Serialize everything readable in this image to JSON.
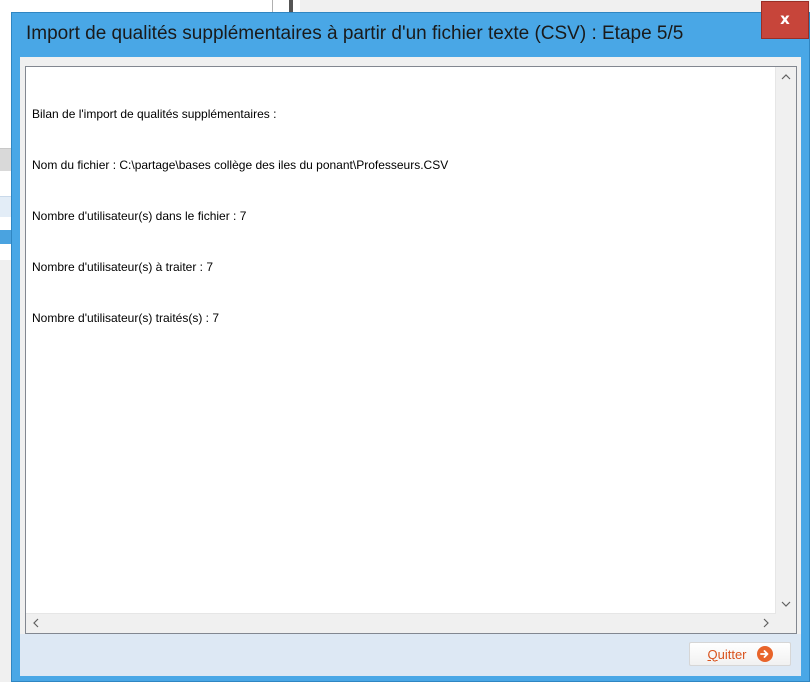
{
  "window": {
    "title": "Import de qualités supplémentaires à partir d'un fichier texte (CSV) : Etape 5/5",
    "close_label": "x"
  },
  "report": {
    "lines": [
      "Bilan de l'import de qualités supplémentaires :",
      "Nom du fichier : C:\\partage\\bases collège des iles du ponant\\Professeurs.CSV",
      "Nombre d'utilisateur(s) dans le fichier : 7",
      "Nombre d'utilisateur(s) à traiter : 7",
      "Nombre d'utilisateur(s) traités(s) : 7"
    ]
  },
  "footer": {
    "quit_first": "Q",
    "quit_rest": "uitter",
    "quit_icon": "arrow-right-circle-icon"
  },
  "colors": {
    "title_bar": "#49a7e6",
    "close_button": "#c7453a",
    "quit_text": "#d9541e",
    "footer_bar": "#dde8f4"
  }
}
